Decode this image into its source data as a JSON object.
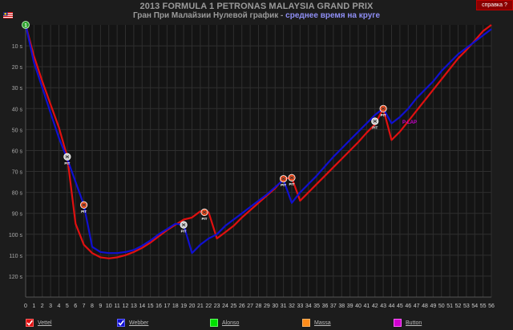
{
  "header": {
    "title_line1": "2013 FORMULA 1 PETRONAS MALAYSIA GRAND PRIX",
    "title_line2_main": "Гран При Малайзии Нулевой график - ",
    "title_line2_accent": "среднее время на круге",
    "help_button": "справка ?"
  },
  "colors": {
    "background": "#1c1c1c",
    "grid": "#2e2e2e",
    "vettel": "#e01010",
    "webber": "#1010d0",
    "alonso": "#00e000",
    "massa": "#ff8c1a",
    "button": "#d000d0",
    "pit_red": "#e84c20",
    "pit_grey": "#cccccc",
    "start_marker": "#2fa02f"
  },
  "chart_data": {
    "type": "line",
    "x_ticks": [
      0,
      1,
      2,
      3,
      4,
      5,
      6,
      7,
      8,
      9,
      10,
      11,
      12,
      13,
      14,
      15,
      16,
      17,
      18,
      19,
      20,
      21,
      22,
      23,
      24,
      25,
      26,
      27,
      28,
      29,
      30,
      31,
      32,
      33,
      34,
      35,
      36,
      37,
      38,
      39,
      40,
      41,
      42,
      43,
      44,
      45,
      46,
      47,
      48,
      49,
      50,
      51,
      52,
      53,
      54,
      55,
      56
    ],
    "y_tick_labels": [
      "10 s",
      "20 s",
      "30 s",
      "40 s",
      "50 s",
      "60 s",
      "70 s",
      "80 s",
      "90 s",
      "100 s",
      "110 s",
      "120 s"
    ],
    "y_tick_values": [
      10,
      20,
      30,
      40,
      50,
      60,
      70,
      80,
      90,
      100,
      110,
      120
    ],
    "xlim": [
      0,
      56
    ],
    "ylim": [
      0,
      130
    ],
    "y_inverted": true,
    "grid": true,
    "series": [
      {
        "name": "Vettel",
        "color_key": "vettel",
        "x": [
          0,
          1,
          2,
          3,
          4,
          5,
          6,
          7,
          8,
          9,
          10,
          11,
          12,
          13,
          14,
          15,
          16,
          17,
          18,
          19,
          20,
          21,
          22,
          23,
          24,
          25,
          26,
          27,
          28,
          29,
          30,
          31,
          32,
          33,
          34,
          35,
          36,
          37,
          38,
          39,
          40,
          41,
          42,
          43,
          44,
          45,
          46,
          47,
          48,
          49,
          50,
          51,
          52,
          53,
          54,
          55,
          56
        ],
        "y": [
          0,
          15,
          27,
          38,
          49,
          63,
          95,
          105,
          109,
          111,
          111.5,
          111,
          110,
          108.5,
          106.5,
          104,
          101,
          98,
          95.5,
          93,
          92,
          89,
          89.5,
          102,
          99,
          96,
          92,
          88.5,
          85,
          81.5,
          78,
          73.5,
          73,
          84,
          80,
          76,
          72,
          68,
          64,
          60,
          56,
          51.5,
          47.5,
          40,
          55,
          51,
          46,
          41,
          36,
          31,
          26,
          21,
          16,
          12,
          7.5,
          3,
          0
        ]
      },
      {
        "name": "Webber",
        "color_key": "webber",
        "x": [
          0,
          1,
          2,
          3,
          4,
          5,
          6,
          7,
          8,
          9,
          10,
          11,
          12,
          13,
          14,
          15,
          16,
          17,
          18,
          19,
          20,
          21,
          22,
          23,
          24,
          25,
          26,
          27,
          28,
          29,
          30,
          31,
          32,
          33,
          34,
          35,
          36,
          37,
          38,
          39,
          40,
          41,
          42,
          43,
          44,
          45,
          46,
          47,
          48,
          49,
          50,
          51,
          52,
          53,
          54,
          55,
          56
        ],
        "y": [
          0,
          18,
          30,
          42,
          54,
          64,
          75,
          86,
          106,
          108.5,
          109,
          109,
          108.5,
          107.5,
          105.5,
          103,
          100,
          97.5,
          95,
          95.5,
          109,
          105,
          102,
          100,
          96,
          93,
          90,
          87,
          84,
          81,
          77.5,
          74,
          85,
          80,
          76,
          72,
          67.5,
          63,
          59,
          55,
          51,
          47,
          43,
          40,
          47,
          44,
          40,
          35,
          31,
          27,
          22,
          18,
          14,
          11,
          8,
          5,
          2
        ]
      },
      {
        "name": "Alonso",
        "color_key": "alonso",
        "x": [],
        "y": []
      },
      {
        "name": "Massa",
        "color_key": "massa",
        "x": [],
        "y": []
      },
      {
        "name": "Button",
        "color_key": "button",
        "x": [],
        "y": []
      }
    ],
    "annotations": [
      {
        "type": "pit",
        "style": "grey",
        "x": 5,
        "y": 63,
        "label": "PIT"
      },
      {
        "type": "pit",
        "style": "red",
        "x": 7,
        "y": 86,
        "label": "PIT"
      },
      {
        "type": "pit",
        "style": "grey",
        "x": 19,
        "y": 95.5,
        "label": "PIT"
      },
      {
        "type": "pit",
        "style": "red",
        "x": 21.5,
        "y": 89.5,
        "label": "PIT"
      },
      {
        "type": "pit",
        "style": "red",
        "x": 31,
        "y": 73.5,
        "label": "PIT"
      },
      {
        "type": "pit",
        "style": "red",
        "x": 32,
        "y": 73,
        "label": "PIT"
      },
      {
        "type": "pit",
        "style": "grey",
        "x": 42,
        "y": 46,
        "label": "PIT"
      },
      {
        "type": "pit",
        "style": "red",
        "x": 43,
        "y": 40,
        "label": "PIT"
      },
      {
        "type": "text",
        "x": 45.3,
        "y": 46,
        "label": "P-LAP",
        "color_key": "button"
      },
      {
        "type": "start",
        "x": 0,
        "y": 0,
        "label": "1"
      }
    ]
  },
  "legend": [
    {
      "name": "Vettel",
      "color_key": "vettel",
      "checked": true
    },
    {
      "name": "Webber",
      "color_key": "webber",
      "checked": true
    },
    {
      "name": "Alonso",
      "color_key": "alonso",
      "checked": false
    },
    {
      "name": "Massa",
      "color_key": "massa",
      "checked": false
    },
    {
      "name": "Button",
      "color_key": "button",
      "checked": false
    }
  ]
}
